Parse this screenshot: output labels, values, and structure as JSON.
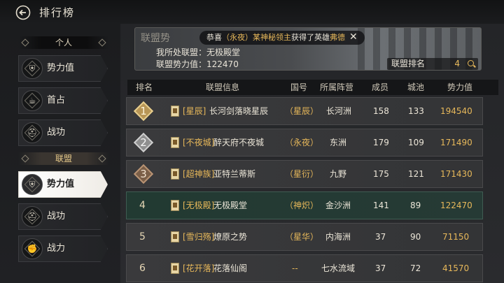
{
  "header": {
    "title": "排行榜"
  },
  "sidebar": {
    "section_personal": "个人",
    "section_alliance": "联盟",
    "personal_items": [
      {
        "label": "势力值",
        "icon": "armor-icon"
      },
      {
        "label": "首占",
        "icon": "tea-icon"
      },
      {
        "label": "战功",
        "icon": "helmet-icon"
      }
    ],
    "alliance_items": [
      {
        "label": "势力值",
        "icon": "armor-icon",
        "active": true
      },
      {
        "label": "战功",
        "icon": "helmet-icon"
      },
      {
        "label": "力",
        "icon": "fist-icon"
      }
    ],
    "alliance_last_full": "战力"
  },
  "banner": {
    "tag": "联盟势",
    "notice_prefix": "恭喜",
    "notice_nation": "（永夜）",
    "notice_lord": "某神秘领主",
    "notice_mid": "获得了英雄",
    "notice_hero": "弗德",
    "my_alliance_label": "我所处联盟：",
    "my_alliance": "无极殿堂",
    "my_power_label": "联盟势力值：",
    "my_power": "122470",
    "rank_label": "联盟排名",
    "rank_value": "4"
  },
  "table": {
    "headers": [
      "排名",
      "联盟信息",
      "国号",
      "所属阵营",
      "成员",
      "城池",
      "势力值"
    ],
    "rows": [
      {
        "rank": "1",
        "tag": "[星辰]",
        "name": "长河剑落晓星辰",
        "nation": "（星辰）",
        "camp": "长河洲",
        "members": "158",
        "cities": "133",
        "power": "194540"
      },
      {
        "rank": "2",
        "tag": "[不夜城]",
        "name": "醉天府不夜城",
        "nation": "（永夜）",
        "camp": "东洲",
        "members": "179",
        "cities": "109",
        "power": "171490"
      },
      {
        "rank": "3",
        "tag": "[超神族]",
        "name": "亚特兰蒂斯",
        "nation": "（星衍）",
        "camp": "九野",
        "members": "175",
        "cities": "121",
        "power": "171430"
      },
      {
        "rank": "4",
        "tag": "[无极殿]",
        "name": "无极殿堂",
        "nation": "（神炽）",
        "camp": "金沙洲",
        "members": "141",
        "cities": "89",
        "power": "122470"
      },
      {
        "rank": "5",
        "tag": "[雪归殇]",
        "name": "燎原之势",
        "nation": "（星华）",
        "camp": "内海洲",
        "members": "37",
        "cities": "90",
        "power": "71150"
      },
      {
        "rank": "6",
        "tag": "[花开落]",
        "name": "花落仙阁",
        "nation": "--",
        "camp": "七水流域",
        "members": "37",
        "cities": "72",
        "power": "41570"
      }
    ]
  },
  "colors": {
    "gold": "#e7b85a",
    "mine_row": "#223a32",
    "active_nav": "#ffffff"
  }
}
